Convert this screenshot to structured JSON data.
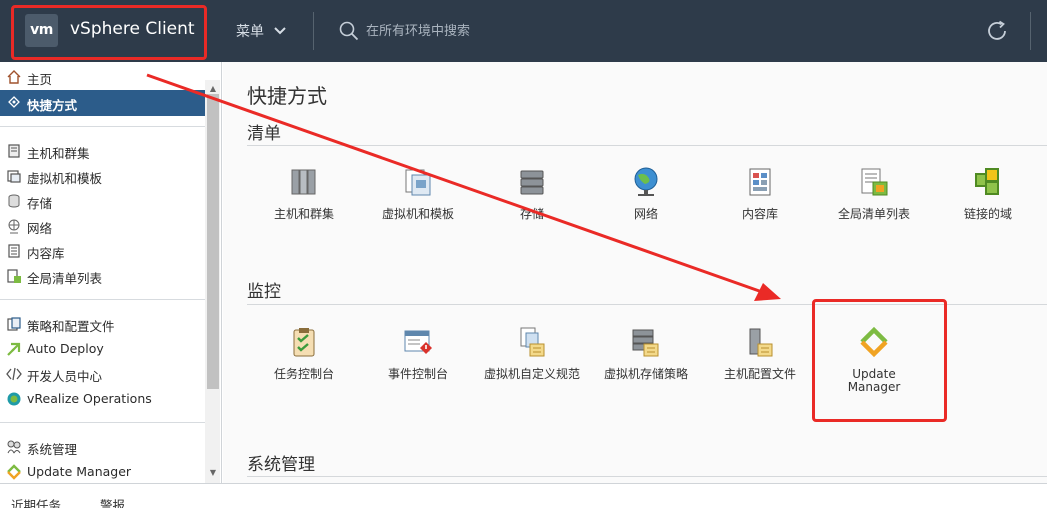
{
  "header": {
    "logo_text": "vm",
    "title": "vSphere Client",
    "menu_label": "菜单",
    "search_placeholder": "在所有环境中搜索"
  },
  "sidebar": {
    "items": [
      {
        "label": "主页",
        "icon": "home-icon"
      },
      {
        "label": "快捷方式",
        "icon": "shortcut-icon",
        "active": true
      },
      {
        "label": "主机和群集",
        "icon": "host-cluster-icon"
      },
      {
        "label": "虚拟机和模板",
        "icon": "vm-template-icon"
      },
      {
        "label": "存储",
        "icon": "storage-icon"
      },
      {
        "label": "网络",
        "icon": "network-icon"
      },
      {
        "label": "内容库",
        "icon": "content-library-icon"
      },
      {
        "label": "全局清单列表",
        "icon": "inventory-list-icon"
      },
      {
        "label": "策略和配置文件",
        "icon": "policy-icon"
      },
      {
        "label": "Auto Deploy",
        "icon": "auto-deploy-icon"
      },
      {
        "label": "开发人员中心",
        "icon": "developer-center-icon"
      },
      {
        "label": "vRealize Operations",
        "icon": "vrealize-icon"
      },
      {
        "label": "系统管理",
        "icon": "administration-icon"
      },
      {
        "label": "Update Manager",
        "icon": "update-manager-icon"
      }
    ]
  },
  "main": {
    "title": "快捷方式",
    "sections": [
      {
        "title": "清单",
        "tiles": [
          {
            "label": "主机和群集",
            "icon": "host-cluster-icon"
          },
          {
            "label": "虚拟机和模板",
            "icon": "vm-template-icon"
          },
          {
            "label": "存储",
            "icon": "storage-icon"
          },
          {
            "label": "网络",
            "icon": "network-globe-icon"
          },
          {
            "label": "内容库",
            "icon": "content-library-icon"
          },
          {
            "label": "全局清单列表",
            "icon": "inventory-list-icon"
          },
          {
            "label": "链接的域",
            "icon": "linked-domain-icon"
          }
        ]
      },
      {
        "title": "监控",
        "tiles": [
          {
            "label": "任务控制台",
            "icon": "task-console-icon"
          },
          {
            "label": "事件控制台",
            "icon": "event-console-icon"
          },
          {
            "label": "虚拟机自定义规范",
            "icon": "vm-customization-icon"
          },
          {
            "label": "虚拟机存储策略",
            "icon": "vm-storage-policy-icon"
          },
          {
            "label": "主机配置文件",
            "icon": "host-profile-icon"
          },
          {
            "label": "Update Manager",
            "icon": "update-manager-icon"
          }
        ]
      },
      {
        "title": "系统管理",
        "tiles": []
      }
    ]
  },
  "bottom_tabs": [
    {
      "label": "近期任务"
    },
    {
      "label": "警报"
    }
  ],
  "colors": {
    "topbar": "#2e3b4a",
    "active_nav": "#2c5c8a",
    "annotation_red": "#ea2a26",
    "update_manager_green": "#7dbb42",
    "update_manager_orange": "#f0a323"
  }
}
